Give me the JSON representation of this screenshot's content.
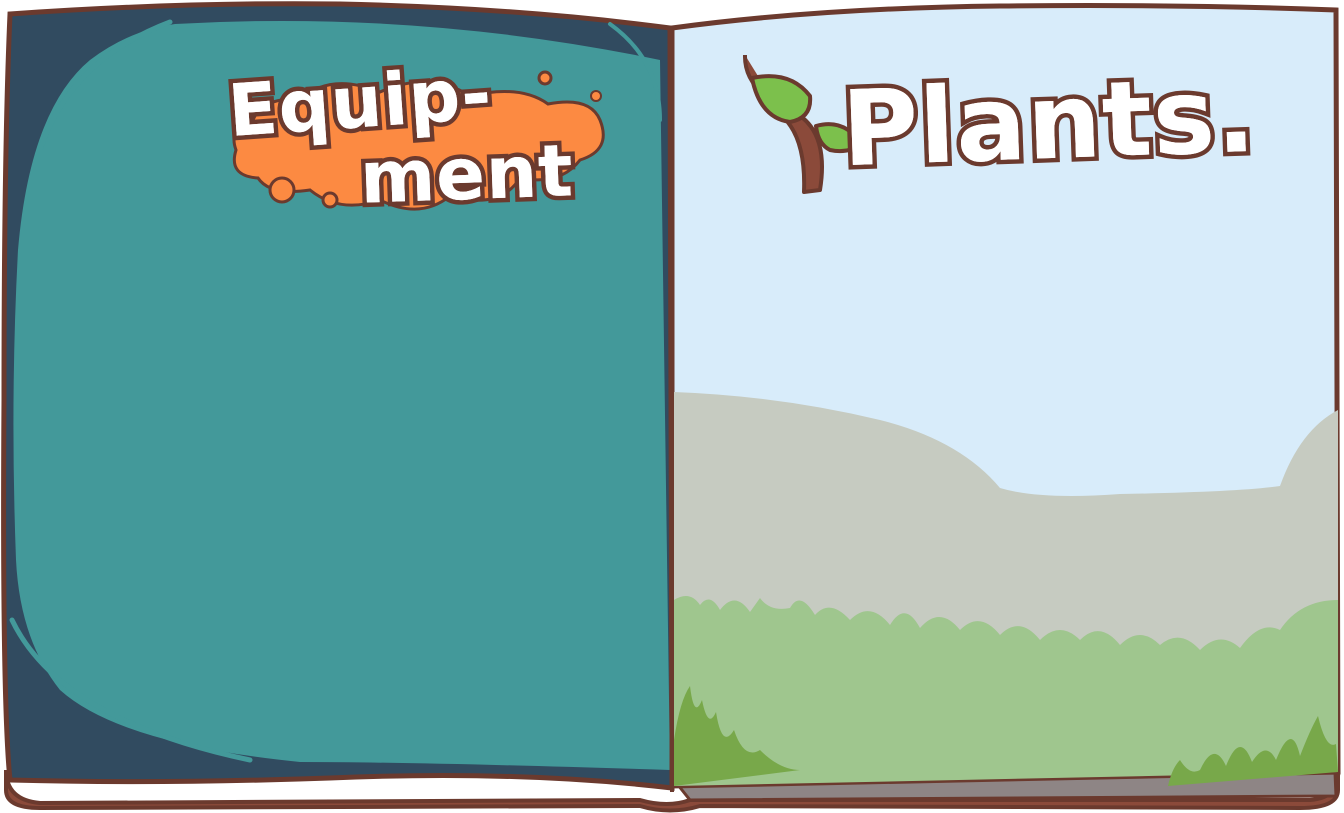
{
  "left_page": {
    "title_line1": "Equip-",
    "title_line2": "ment",
    "background_color": "#43999a",
    "border_color": "#314b60",
    "splat_color": "#fc8a42"
  },
  "right_page": {
    "title": "Plants.",
    "sky_color": "#d8ecfa",
    "hill_color": "#c6cbc1",
    "grass_color": "#9fc68e",
    "dark_grass_color": "#78a84a",
    "leaf_color": "#7cc04c"
  },
  "book": {
    "outline_color": "#6b3a2e",
    "cover_color": "#8b4a3a"
  }
}
